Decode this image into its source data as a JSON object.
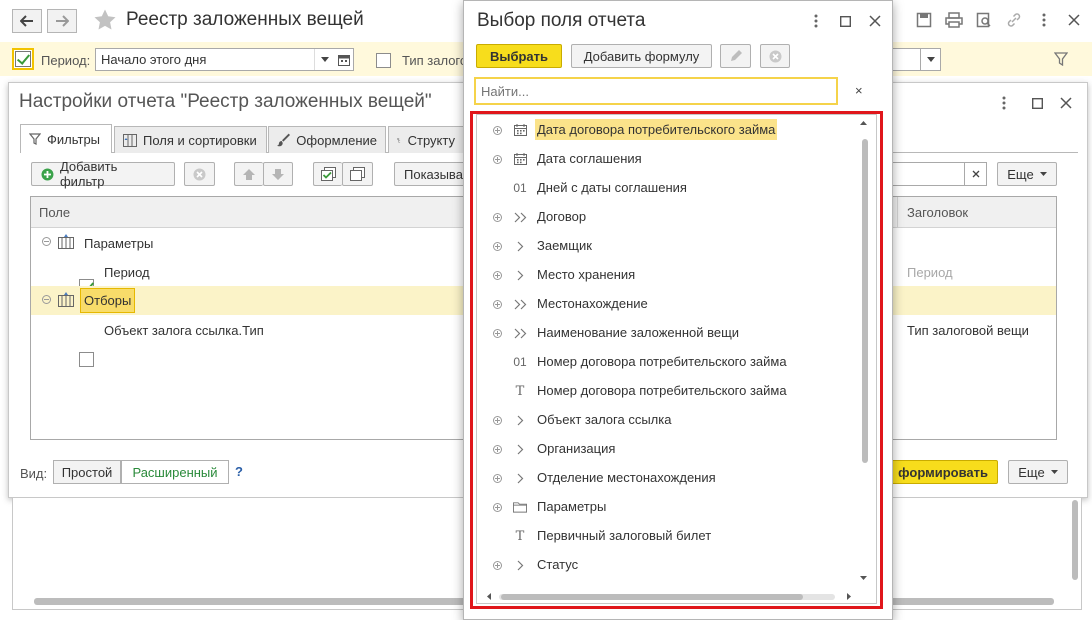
{
  "main_window": {
    "title": "Реестр заложенных вещей",
    "period_label": "Период:",
    "period_value": "Начало этого дня",
    "type_label": "Тип залогов"
  },
  "settings": {
    "title": "Настройки отчета \"Реестр заложенных вещей\"",
    "tabs": [
      "Фильтры",
      "Поля и сортировки",
      "Оформление",
      "Структу"
    ],
    "add_filter_label": "Добавить фильтр",
    "show_label": "Показыва",
    "more_label": "Еще",
    "col_field": "Поле",
    "col_header": "Заголовок",
    "rows": [
      {
        "label": "Параметры",
        "header": ""
      },
      {
        "label": "Период",
        "header": "Период"
      },
      {
        "label": "Отборы",
        "header": ""
      },
      {
        "label": "Объект залога ссылка.Тип",
        "header": "Тип залоговой вещи"
      }
    ],
    "view_label": "Вид:",
    "view_simple": "Простой",
    "view_extended": "Расширенный",
    "help": "?",
    "form_label": "формировать",
    "more_bottom_label": "Еще"
  },
  "popup": {
    "title": "Выбор поля отчета",
    "select_label": "Выбрать",
    "add_formula_label": "Добавить формулу",
    "search_placeholder": "Найти...",
    "clear_search": "×",
    "items": [
      {
        "label": "Дата договора потребительского займа",
        "icon": "calendar-icon",
        "expand": true,
        "selected": true
      },
      {
        "label": "Дата соглашения",
        "icon": "calendar-icon",
        "expand": true
      },
      {
        "label": "Дней с даты соглашения",
        "icon": "number-icon",
        "expand": false
      },
      {
        "label": "Договор",
        "icon": "double-chevron-icon",
        "expand": true
      },
      {
        "label": "Заемщик",
        "icon": "chevron-icon",
        "expand": true
      },
      {
        "label": "Место хранения",
        "icon": "chevron-icon",
        "expand": true
      },
      {
        "label": "Местонахождение",
        "icon": "double-chevron-icon",
        "expand": true
      },
      {
        "label": "Наименование заложенной вещи",
        "icon": "double-chevron-icon",
        "expand": true
      },
      {
        "label": "Номер договора потребительского займа",
        "icon": "number-icon",
        "expand": false
      },
      {
        "label": "Номер договора потребительского займа",
        "icon": "text-icon",
        "expand": false
      },
      {
        "label": "Объект залога ссылка",
        "icon": "chevron-icon",
        "expand": true
      },
      {
        "label": "Организация",
        "icon": "chevron-icon",
        "expand": true
      },
      {
        "label": "Отделение местонахождения",
        "icon": "chevron-icon",
        "expand": true
      },
      {
        "label": "Параметры",
        "icon": "folder-icon",
        "expand": true
      },
      {
        "label": "Первичный залоговый билет",
        "icon": "text-icon",
        "expand": false
      },
      {
        "label": "Статус",
        "icon": "chevron-icon",
        "expand": true
      }
    ],
    "number_glyph": "01",
    "text_glyph": "T"
  },
  "colors": {
    "accent_yellow": "#f7dd1c",
    "selection": "#fbe38a",
    "highlight_frame": "#e0161b",
    "green_text": "#2a8a3a"
  }
}
